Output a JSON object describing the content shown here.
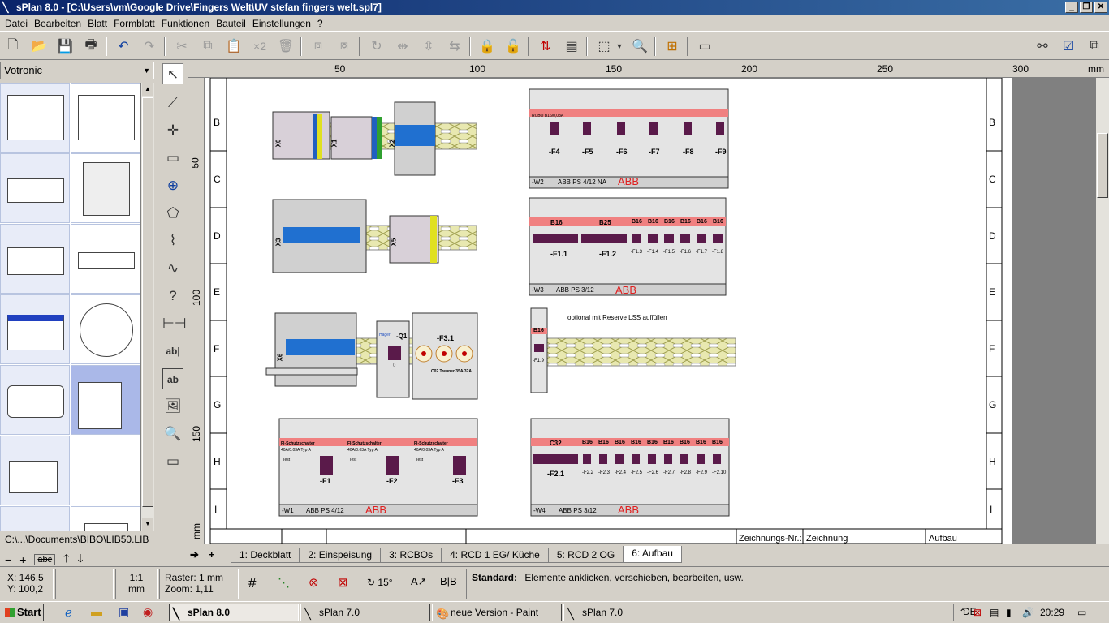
{
  "window": {
    "title": "sPlan 8.0 - [C:\\Users\\vm\\Google Drive\\Fingers Welt\\UV stefan fingers welt.spl7]"
  },
  "menu": [
    "Datei",
    "Bearbeiten",
    "Blatt",
    "Formblatt",
    "Funktionen",
    "Bauteil",
    "Einstellungen",
    "?"
  ],
  "toolbar": {
    "copy_x2": "×2"
  },
  "library": {
    "name": "Votronic",
    "path": "C:\\...\\Documents\\BIBO\\LIB50.LIB",
    "abc": "abc"
  },
  "drawtools": {
    "question": "?",
    "text_tool": "ab|",
    "text_frame": "ab"
  },
  "ruler": {
    "h_ticks": [
      "50",
      "100",
      "150",
      "200",
      "250",
      "300"
    ],
    "v_ticks": [
      "50",
      "100",
      "150"
    ],
    "unit": "mm"
  },
  "sheet": {
    "rows": [
      "B",
      "C",
      "D",
      "E",
      "F",
      "G",
      "H",
      "I"
    ],
    "footer": {
      "zno_label": "Zeichnungs-Nr.:",
      "zno_value": "Zeichnung",
      "title": "Aufbau"
    },
    "terminal_labels": [
      "X0",
      "X1",
      "X2",
      "X3",
      "X5",
      "X6"
    ],
    "note": "optional mit Reserve LSS auffüllen",
    "brand": "ABB",
    "modules": {
      "w1": {
        "label": "-W1",
        "type": "ABB PS 4/12",
        "rcds": [
          "-F1",
          "-F2",
          "-F3"
        ],
        "rcd_title": "FI-Schutzschalter",
        "rcd_spec": "40A/0.03A Typ A",
        "test": "Test"
      },
      "w2": {
        "label": "-W2",
        "type": "ABB PS 4/12 NA",
        "rcbos": [
          "-F4",
          "-F5",
          "-F6",
          "-F7",
          "-F8",
          "-F9"
        ],
        "rcbo_text": "RCBO B16/0,03A"
      },
      "w3": {
        "label": "-W3",
        "type": "ABB PS 3/12",
        "big": [
          "-F1.1",
          "-F1.2"
        ],
        "big_rating": [
          "B16",
          "B25"
        ],
        "small": [
          "-F1.3",
          "-F1.4",
          "-F1.5",
          "-F1.6",
          "-F1.7",
          "-F1.8"
        ],
        "small_rating": "B16"
      },
      "w4": {
        "label": "-W4",
        "type": "ABB PS 3/12",
        "big": "-F2.1",
        "big_rating": "C32",
        "small": [
          "-F2.2",
          "-F2.3",
          "-F2.4",
          "-F2.5",
          "-F2.6",
          "-F2.7",
          "-F2.8",
          "-F2.9",
          "-F2.10"
        ],
        "small_rating": "B16"
      },
      "f19": {
        "label": "-F1.9",
        "rating": "B16"
      },
      "main": {
        "q1": "-Q1",
        "brand": "Hager",
        "f31": "-F3.1",
        "f31_text": "C02 Trenner 35A/32A",
        "q1_zero": "0"
      }
    }
  },
  "tabs": [
    "1: Deckblatt",
    "2: Einspeisung",
    "3: RCBOs",
    "4: RCD 1 EG/ Küche",
    "5: RCD 2  OG",
    "6: Aufbau"
  ],
  "active_tab": 5,
  "status": {
    "x": "X:   146,5",
    "y": "Y:   100,2",
    "scale": "1:1",
    "scale_unit": "mm",
    "grid": "Raster: 1 mm",
    "zoom": "Zoom:  1,11",
    "angle": "15°",
    "mode_label": "Standard:",
    "mode_text": "Elemente anklicken, verschieben, bearbeiten, usw."
  },
  "taskbar": {
    "start": "Start",
    "items": [
      "sPlan 8.0",
      "sPlan 7.0",
      "neue Version - Paint",
      "sPlan 7.0"
    ],
    "lang": "DE",
    "time": "20:29"
  },
  "colors": {
    "titlebar": "#0a246a",
    "rcd_red": "#f08080",
    "din_rail": "#d8d890",
    "terminal_blue": "#2070d0"
  }
}
